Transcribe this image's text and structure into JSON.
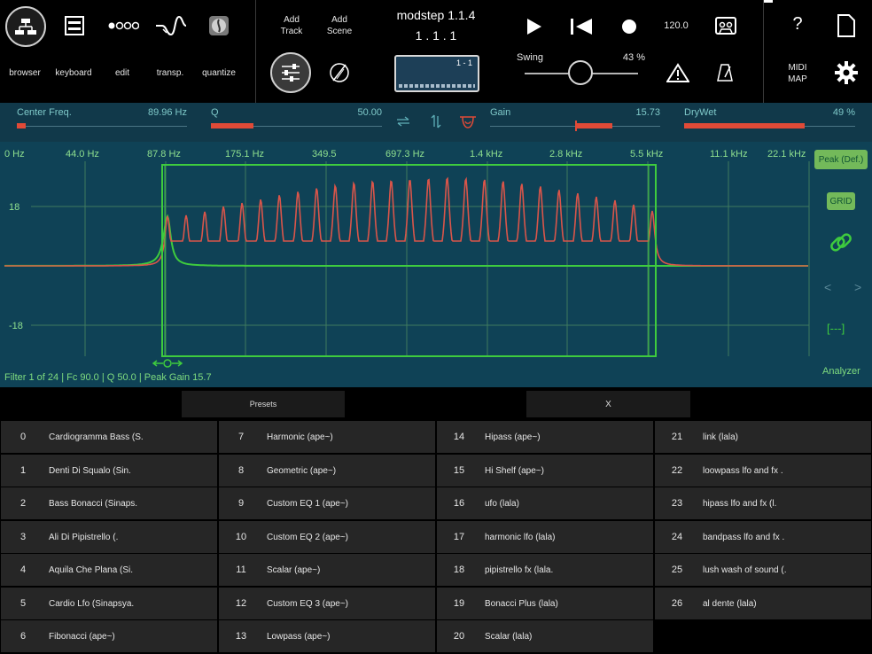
{
  "toolbar": {
    "nav_labels": [
      "browser",
      "keyboard",
      "edit",
      "transp.",
      "quantize"
    ],
    "add_track": [
      "Add",
      "Track"
    ],
    "add_scene": [
      "Add",
      "Scene"
    ],
    "app_title": "modstep 1.1.4",
    "position": "1 . 1 . 1",
    "scene_box_label": "1 - 1",
    "tempo": "120.0",
    "swing_label": "Swing",
    "swing_value": "43 %",
    "swing_level": 0.43,
    "help": "?",
    "midi_map": [
      "MIDI",
      "MAP"
    ]
  },
  "params": {
    "center_freq": {
      "label": "Center Freq.",
      "value": "89.96 Hz"
    },
    "q": {
      "label": "Q",
      "value": "50.00"
    },
    "gain": {
      "label": "Gain",
      "value": "15.73"
    },
    "drywet": {
      "label": "DryWet",
      "value": "49 %"
    }
  },
  "analyzer": {
    "freq_labels": [
      "0 Hz",
      "44.0 Hz",
      "87.8 Hz",
      "175.1 Hz",
      "349.5",
      "697.3 Hz",
      "1.4 kHz",
      "2.8 kHz",
      "5.5 kHz",
      "11.1 kHz",
      "22.1 kHz"
    ],
    "db_labels": [
      "18",
      "-18"
    ],
    "peak_button": "Peak (Def.)",
    "grid_button": "GRID",
    "nav_prev": "<",
    "nav_next": ">",
    "bracket": "[---]",
    "status": "Filter 1 of 24 | Fc 90.0 | Q 50.0 | Peak Gain 15.7",
    "label": "Analyzer",
    "colors": {
      "response": "#d9554a",
      "filter": "#3ecb3e",
      "grid": "#3f7a5f",
      "bg": "#0f4256"
    }
  },
  "presets_bar": {
    "presets": "Presets",
    "close": "X"
  },
  "presets": [
    {
      "n": "0",
      "name": "Cardiogramma Bass (S."
    },
    {
      "n": "1",
      "name": "Denti Di Squalo (Sin."
    },
    {
      "n": "2",
      "name": "Bass Bonacci (Sinaps."
    },
    {
      "n": "3",
      "name": "Ali Di Pipistrello (."
    },
    {
      "n": "4",
      "name": "Aquila Che Plana (Si."
    },
    {
      "n": "5",
      "name": "Cardio Lfo (Sinapsya."
    },
    {
      "n": "6",
      "name": "Fibonacci (ape~)"
    },
    {
      "n": "7",
      "name": "Harmonic (ape~)"
    },
    {
      "n": "8",
      "name": "Geometric (ape~)"
    },
    {
      "n": "9",
      "name": "Custom EQ 1 (ape~)"
    },
    {
      "n": "10",
      "name": "Custom EQ 2 (ape~)"
    },
    {
      "n": "11",
      "name": "Scalar (ape~)"
    },
    {
      "n": "12",
      "name": "Custom EQ 3 (ape~)"
    },
    {
      "n": "13",
      "name": "Lowpass (ape~)"
    },
    {
      "n": "14",
      "name": "Hipass (ape~)"
    },
    {
      "n": "15",
      "name": "Hi Shelf (ape~)"
    },
    {
      "n": "16",
      "name": "ufo (lala)"
    },
    {
      "n": "17",
      "name": "harmonic lfo (lala)"
    },
    {
      "n": "18",
      "name": "pipistrello fx (lala."
    },
    {
      "n": "19",
      "name": "Bonacci Plus (lala)"
    },
    {
      "n": "20",
      "name": "Scalar (lala)"
    },
    {
      "n": "21",
      "name": "link (lala)"
    },
    {
      "n": "22",
      "name": "loowpass lfo and fx ."
    },
    {
      "n": "23",
      "name": "hipass lfo and fx (l."
    },
    {
      "n": "24",
      "name": "bandpass lfo and fx ."
    },
    {
      "n": "25",
      "name": "lush wash of sound (."
    },
    {
      "n": "26",
      "name": "al dente (lala)"
    }
  ]
}
